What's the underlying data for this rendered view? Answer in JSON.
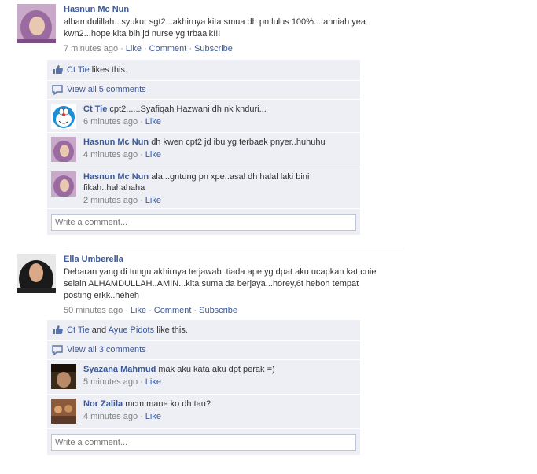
{
  "stories": [
    {
      "actor": "Hasnun Mc Nun",
      "message": "alhamdulillah...syukur sgt2...akhirnya kita smua dh pn lulus 100%...tahniah yea kwn2...hope kita blh jd nurse yg trbaaik!!!",
      "time": "7 minutes ago",
      "like_label": "Like",
      "comment_label": "Comment",
      "subscribe_label": "Subscribe",
      "likes": {
        "name1": "Ct Tie",
        "suffix": "likes this."
      },
      "view_all": "View all 5 comments",
      "comments": [
        {
          "name": "Ct Tie",
          "text": "cpt2......Syafiqah Hazwani dh nk knduri...",
          "time": "6 minutes ago",
          "like": "Like",
          "avatar_icon": "doraemon-avatar"
        },
        {
          "name": "Hasnun Mc Nun",
          "text": "dh kwen cpt2 jd ibu yg terbaek pnyer..huhuhu",
          "time": "4 minutes ago",
          "like": "Like",
          "avatar_icon": "hijab-avatar"
        },
        {
          "name": "Hasnun Mc Nun",
          "text": "ala...gntung pn xpe..asal dh halal laki bini fikah..hahahaha",
          "time": "2 minutes ago",
          "like": "Like",
          "avatar_icon": "hijab-avatar"
        }
      ],
      "comment_placeholder": "Write a comment..."
    },
    {
      "actor": "Ella Umberella",
      "message": "Debaran yang di tungu akhirnya terjawab..tiada ape yg dpat aku ucapkan kat cnie selain ALHAMDULLAH..AMIN...kita suma da berjaya...horey,6t heboh tempat posting erkk..heheh",
      "time": "50 minutes ago",
      "like_label": "Like",
      "comment_label": "Comment",
      "subscribe_label": "Subscribe",
      "likes": {
        "name1": "Ct Tie",
        "and": "and",
        "name2": "Ayue Pidots",
        "suffix": "like this."
      },
      "view_all": "View all 3 comments",
      "comments": [
        {
          "name": "Syazana Mahmud",
          "text": "mak aku kata aku dpt perak =)",
          "time": "5 minutes ago",
          "like": "Like",
          "avatar_icon": "portrait-avatar"
        },
        {
          "name": "Nor Zalila",
          "text": "mcm mane ko dh tau?",
          "time": "4 minutes ago",
          "like": "Like",
          "avatar_icon": "group-photo-avatar"
        }
      ],
      "comment_placeholder": "Write a comment..."
    }
  ],
  "colors": {
    "link": "#3b5998",
    "ufi_bg": "#edeff4",
    "meta": "#808080",
    "input_border": "#bdc7d8"
  }
}
